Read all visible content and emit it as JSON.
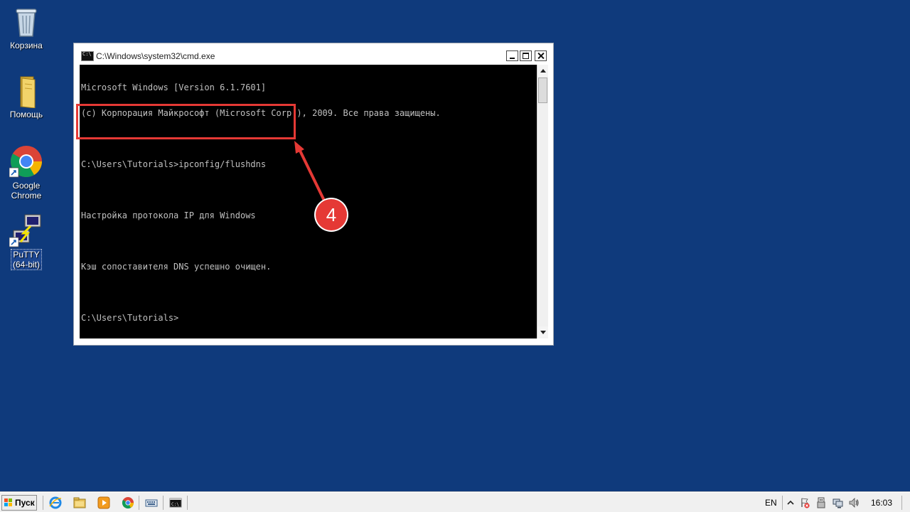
{
  "desktop": {
    "icons": [
      {
        "label": "Корзина"
      },
      {
        "label": "Помощь"
      },
      {
        "label": "Google Chrome"
      },
      {
        "label": "PuTTY (64-bit)"
      }
    ]
  },
  "cmd_window": {
    "title": "C:\\Windows\\system32\\cmd.exe",
    "lines": [
      "Microsoft Windows [Version 6.1.7601]",
      "(c) Корпорация Майкрософт (Microsoft Corp.), 2009. Все права защищены.",
      "",
      "C:\\Users\\Tutorials>ipconfig/flushdns",
      "",
      "Настройка протокола IP для Windows",
      "",
      "Кэш сопоставителя DNS успешно очищен.",
      "",
      "C:\\Users\\Tutorials>"
    ]
  },
  "annotation": {
    "step_number": "4",
    "color": "#e53935"
  },
  "taskbar": {
    "start_label": "Пуск",
    "pinned": [
      "internet-explorer-icon",
      "explorer-folder-icon",
      "media-player-icon",
      "chrome-icon",
      "onscreen-keyboard-icon",
      "cmd-icon"
    ],
    "language": "EN",
    "clock": "16:03"
  },
  "colors": {
    "desktop_bg": "#0f3a7c",
    "console_bg": "#000000",
    "console_fg": "#c0c0c0",
    "accent_red": "#e53935"
  }
}
